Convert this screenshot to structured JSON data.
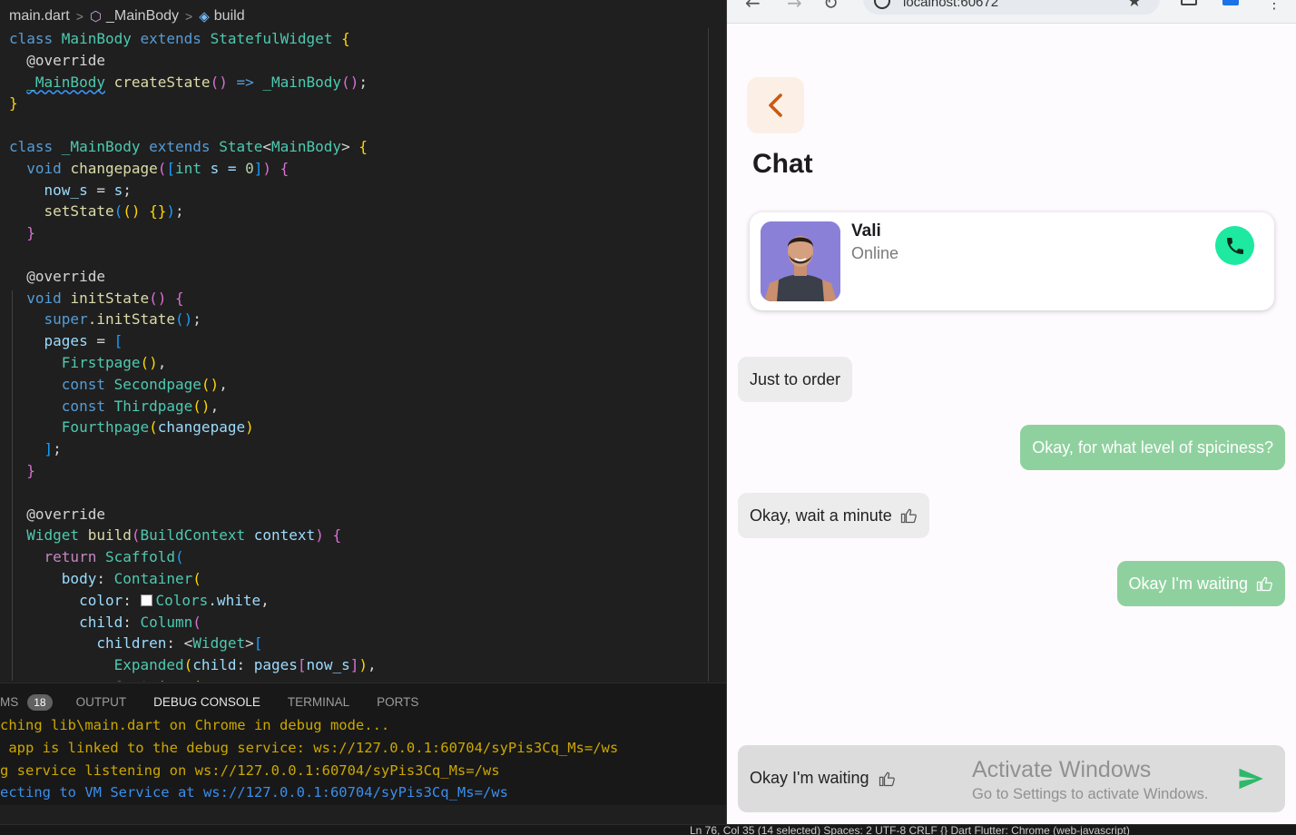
{
  "breadcrumb": {
    "file": "main.dart",
    "class": "_MainBody",
    "method": "build"
  },
  "panel": {
    "tabs": [
      "MS",
      "OUTPUT",
      "DEBUG CONSOLE",
      "TERMINAL",
      "PORTS"
    ],
    "badge": "18",
    "active_tab": "DEBUG CONSOLE",
    "console_lines": [
      {
        "text": "ching lib\\main.dart on Chrome in debug mode...",
        "color": "#cca700"
      },
      {
        "text": " app is linked to the debug service: ws://127.0.0.1:60704/syPis3Cq_Ms=/ws",
        "color": "#cca700"
      },
      {
        "text": "g service listening on ws://127.0.0.1:60704/syPis3Cq_Ms=/ws",
        "color": "#cca700"
      },
      {
        "text": "ecting to VM Service at ws://127.0.0.1:60704/syPis3Cq_Ms=/ws",
        "color": "#3b8eea"
      }
    ]
  },
  "status_bar": {
    "text": "Ln 76, Col 35 (14 selected)   Spaces: 2   UTF-8   CRLF   {} Dart   Flutter: Chrome (web-javascript)"
  },
  "browser": {
    "url": "localhost:60672"
  },
  "app": {
    "title": "Chat",
    "contact": {
      "name": "Vali",
      "status": "Online"
    },
    "messages": [
      {
        "text": "Just to order",
        "from": "them",
        "thumb": false
      },
      {
        "text": "Okay, for what level of spiciness?",
        "from": "me",
        "thumb": false
      },
      {
        "text": "Okay, wait a minute",
        "from": "them",
        "thumb": true
      },
      {
        "text": "Okay I'm waiting",
        "from": "me",
        "thumb": true
      }
    ],
    "composer_text": "Okay I'm waiting",
    "colors": {
      "accent_orange": "#c75b12",
      "call_green": "#1de9a0",
      "bubble_out": "#8fd19e",
      "bubble_in": "#ececec"
    }
  },
  "watermark": {
    "line1": "Activate Windows",
    "line2": "Go to Settings to activate Windows."
  },
  "icons": [
    "symbol-class-icon",
    "cube-icon",
    "back-chevron-icon",
    "phone-icon",
    "thumbs-up-icon",
    "send-icon",
    "star-icon",
    "info-icon",
    "kebab-menu-icon"
  ],
  "code_lines": [
    [
      [
        "class ",
        "k"
      ],
      [
        "MainBody ",
        "t"
      ],
      [
        "extends ",
        "k"
      ],
      [
        "StatefulWidget ",
        "t"
      ],
      [
        "{",
        "p1"
      ]
    ],
    [
      [
        "  @override",
        "d"
      ]
    ],
    [
      [
        "  ",
        "d"
      ],
      [
        "_MainBody",
        "t sq"
      ],
      [
        " createState",
        "f"
      ],
      [
        "()",
        "p2"
      ],
      [
        " => ",
        "k"
      ],
      [
        "_MainBody",
        "t"
      ],
      [
        "()",
        "p2"
      ],
      [
        ";",
        "d"
      ]
    ],
    [
      [
        "}",
        "p1"
      ]
    ],
    [
      [
        "",
        "d"
      ]
    ],
    [
      [
        "class ",
        "k"
      ],
      [
        "_MainBody ",
        "t"
      ],
      [
        "extends ",
        "k"
      ],
      [
        "State",
        "t"
      ],
      [
        "<",
        "d"
      ],
      [
        "MainBody",
        "t"
      ],
      [
        "> ",
        "d"
      ],
      [
        "{",
        "p1"
      ]
    ],
    [
      [
        "  ",
        "d"
      ],
      [
        "void ",
        "k"
      ],
      [
        "changepage",
        "f"
      ],
      [
        "(",
        "p2"
      ],
      [
        "[",
        "p3"
      ],
      [
        "int ",
        "t"
      ],
      [
        "s = ",
        "v"
      ],
      [
        "0",
        "n"
      ],
      [
        "]",
        "p3"
      ],
      [
        ")",
        "p2"
      ],
      [
        " {",
        "p2"
      ]
    ],
    [
      [
        "    ",
        "d"
      ],
      [
        "now_s",
        "v"
      ],
      [
        " = ",
        "d"
      ],
      [
        "s",
        "v"
      ],
      [
        ";",
        "d"
      ]
    ],
    [
      [
        "    ",
        "d"
      ],
      [
        "setState",
        "f"
      ],
      [
        "(",
        "p3"
      ],
      [
        "() ",
        "p1"
      ],
      [
        "{}",
        "p1"
      ],
      [
        ")",
        "p3"
      ],
      [
        ";",
        "d"
      ]
    ],
    [
      [
        "  }",
        "p2"
      ]
    ],
    [
      [
        "",
        "d"
      ]
    ],
    [
      [
        "  @override",
        "d"
      ]
    ],
    [
      [
        "  ",
        "d"
      ],
      [
        "void ",
        "k"
      ],
      [
        "initState",
        "f"
      ],
      [
        "() ",
        "p2"
      ],
      [
        "{",
        "p2"
      ]
    ],
    [
      [
        "    ",
        "d"
      ],
      [
        "super",
        "k"
      ],
      [
        ".initState",
        "f"
      ],
      [
        "()",
        "p3"
      ],
      [
        ";",
        "d"
      ]
    ],
    [
      [
        "    ",
        "d"
      ],
      [
        "pages",
        "v"
      ],
      [
        " = ",
        "d"
      ],
      [
        "[",
        "p3"
      ]
    ],
    [
      [
        "      ",
        "d"
      ],
      [
        "Firstpage",
        "t"
      ],
      [
        "()",
        "p1"
      ],
      [
        ",",
        "d"
      ]
    ],
    [
      [
        "      ",
        "d"
      ],
      [
        "const ",
        "k"
      ],
      [
        "Secondpage",
        "t"
      ],
      [
        "()",
        "p1"
      ],
      [
        ",",
        "d"
      ]
    ],
    [
      [
        "      ",
        "d"
      ],
      [
        "const ",
        "k"
      ],
      [
        "Thirdpage",
        "t"
      ],
      [
        "()",
        "p1"
      ],
      [
        ",",
        "d"
      ]
    ],
    [
      [
        "      ",
        "d"
      ],
      [
        "Fourthpage",
        "t"
      ],
      [
        "(",
        "p1"
      ],
      [
        "changepage",
        "v"
      ],
      [
        ")",
        "p1"
      ]
    ],
    [
      [
        "    ",
        "d"
      ],
      [
        "]",
        "p3"
      ],
      [
        ";",
        "d"
      ]
    ],
    [
      [
        "  }",
        "p2"
      ]
    ],
    [
      [
        "",
        "d"
      ]
    ],
    [
      [
        "  @override",
        "d"
      ]
    ],
    [
      [
        "  ",
        "d"
      ],
      [
        "Widget ",
        "t"
      ],
      [
        "build",
        "f"
      ],
      [
        "(",
        "p2"
      ],
      [
        "BuildContext ",
        "t"
      ],
      [
        "context",
        "v"
      ],
      [
        ") ",
        "p2"
      ],
      [
        "{",
        "p2"
      ]
    ],
    [
      [
        "    ",
        "d"
      ],
      [
        "return ",
        "c"
      ],
      [
        "Scaffold",
        "t"
      ],
      [
        "(",
        "p3"
      ]
    ],
    [
      [
        "      ",
        "d"
      ],
      [
        "body",
        "v"
      ],
      [
        ": ",
        "d"
      ],
      [
        "Container",
        "t"
      ],
      [
        "(",
        "p1"
      ]
    ],
    [
      [
        "        ",
        "d"
      ],
      [
        "color",
        "v"
      ],
      [
        ": ",
        "d"
      ],
      [
        "SWATCH",
        "sw"
      ],
      [
        "Colors",
        "t"
      ],
      [
        ".white",
        "v"
      ],
      [
        ",",
        "d"
      ]
    ],
    [
      [
        "        ",
        "d"
      ],
      [
        "child",
        "v"
      ],
      [
        ": ",
        "d"
      ],
      [
        "Column",
        "t"
      ],
      [
        "(",
        "p2"
      ]
    ],
    [
      [
        "          ",
        "d"
      ],
      [
        "children",
        "v"
      ],
      [
        ": <",
        "d"
      ],
      [
        "Widget",
        "t"
      ],
      [
        ">",
        "d"
      ],
      [
        "[",
        "p3"
      ]
    ],
    [
      [
        "            ",
        "d"
      ],
      [
        "Expanded",
        "t"
      ],
      [
        "(",
        "p1"
      ],
      [
        "child",
        "v"
      ],
      [
        ": ",
        "d"
      ],
      [
        "pages",
        "v"
      ],
      [
        "[",
        "p2"
      ],
      [
        "now_s",
        "v"
      ],
      [
        "]",
        "p2"
      ],
      [
        ")",
        "p1"
      ],
      [
        ",",
        "d"
      ]
    ],
    [
      [
        "            ",
        "d"
      ],
      [
        "Container",
        "t"
      ],
      [
        "(",
        "p1"
      ]
    ]
  ]
}
